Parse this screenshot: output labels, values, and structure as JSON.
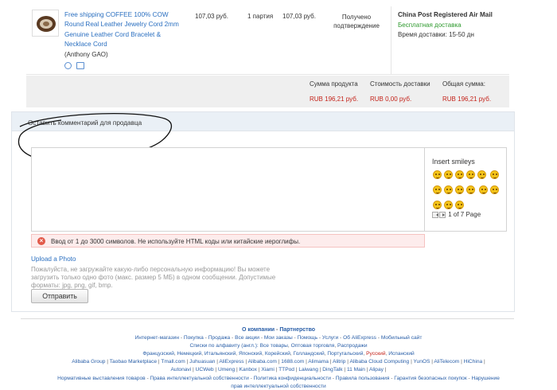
{
  "order": {
    "product_title": "Free shipping COFFEE 100% COW Round Real Leather Jewelry Cord 2mm Genuine Leather Cord Bracelet & Necklace Cord",
    "seller": "(Anthony GAO)",
    "icons": [
      "alarm-clock-icon",
      "card-icon"
    ],
    "unit_price": "107,03 руб.",
    "quantity": "1 партия",
    "total_price": "107,03 руб.",
    "status": "Получено подтверждение",
    "shipping": {
      "method": "China Post Registered Air Mail",
      "cost_note": "Бесплатная доставка",
      "delivery_time": "Время доставки: 15-50 дн"
    }
  },
  "totals": {
    "product_sum_label": "Сумма продукта",
    "product_sum_value": "RUB 196,21 руб.",
    "shipping_cost_label": "Стоимость доставки",
    "shipping_cost_value": "RUB 0,00 руб.",
    "total_label": "Общая сумма:",
    "total_value": "RUB 196,21 руб."
  },
  "comment": {
    "title": "Оставить комментарий для продавца",
    "textarea_value": "",
    "smileys": {
      "title": "Insert smileys",
      "page_text": "1 of 7 Page",
      "count": 15
    },
    "error_text": "Ввод от 1 до 3000 символов. Не используйте HTML коды или китайские иероглифы.",
    "upload_link": "Upload a Photo",
    "upload_note": "Пожалуйста, не загружайте какую-либо персональную информацию! Вы можете загрузить только одно фото (макс. размер 5 МБ) в одном сообщении. Допустимые форматы: jpg, png, gif, bmp.",
    "send_button": "Отправить"
  },
  "footer": {
    "heading_company": "О компании",
    "heading_partnership": "Партнерство",
    "line1": [
      "Интернет-магазин",
      "Покупка",
      "Продажа",
      "Все акции",
      "Мои заказы",
      "Помощь",
      "Услуги",
      "Об AliExpress",
      "Мобильный сайт"
    ],
    "line2_prefix": "Списки по алфавиту (англ.):",
    "line2": [
      "Все товары",
      "Оптовая торговля",
      "Распродажи"
    ],
    "line3": [
      "Французский",
      "Немецкий",
      "Итальянский",
      "Японский",
      "Корейский",
      "Голландский",
      "Португальский"
    ],
    "line3_red": "Русский",
    "line3_last": "Испанский",
    "line4": [
      "Alibaba Group",
      "Taobao Marketplace",
      "Tmall.com",
      "Juhuasuan",
      "AliExpress",
      "Alibaba.com",
      "1688.com",
      "Alimama",
      "Alitrip",
      "Alibaba Cloud Computing",
      "YunOS",
      "AliTelecom",
      "HiChina"
    ],
    "line5": [
      "Autonavi",
      "UCWeb",
      "Umeng",
      "Kanbox",
      "Xiami",
      "TTPod",
      "Laiwang",
      "DingTalk",
      "11 Main",
      "Alipay"
    ],
    "line6": [
      "Нормативные выставления товаров",
      "Права интеллектуальной собственности",
      "Политика конфиденциальности",
      "Правила пользования",
      "Гарантия безопасных покупок",
      "Нарушение"
    ],
    "line7": "прав интеллектуальной собственности"
  }
}
